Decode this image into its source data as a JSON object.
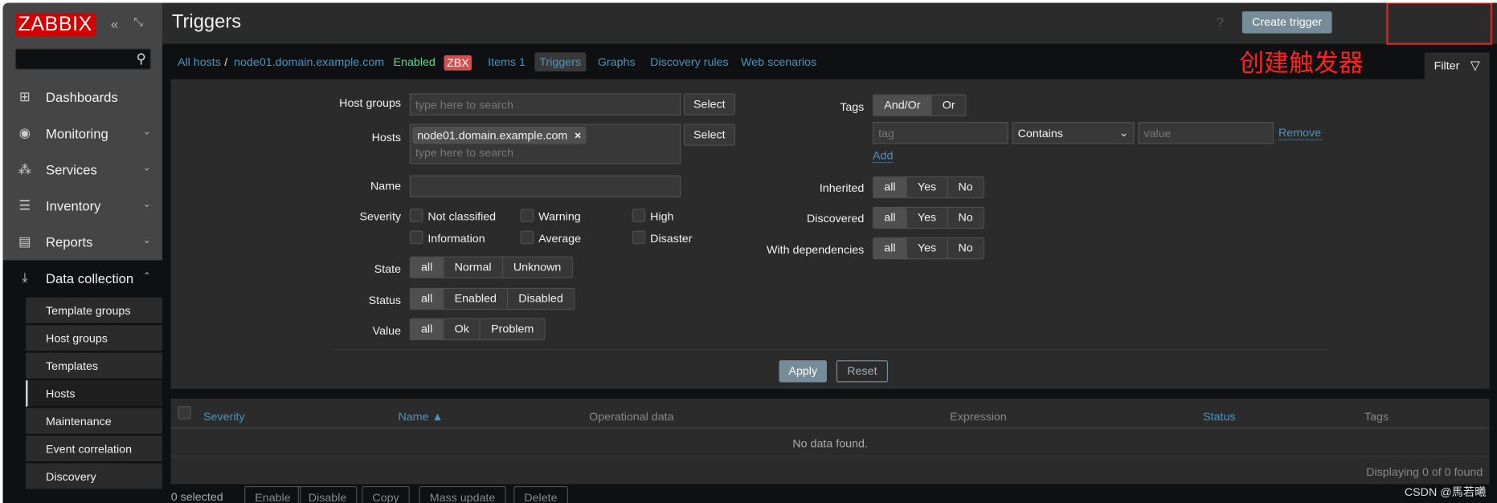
{
  "sidebar": {
    "logo": "ZABBIX",
    "search_placeholder": "",
    "items": [
      {
        "label": "Dashboards",
        "icon": "dashboard-icon"
      },
      {
        "label": "Monitoring",
        "icon": "eye-icon"
      },
      {
        "label": "Services",
        "icon": "hierarchy-icon"
      },
      {
        "label": "Inventory",
        "icon": "list-icon"
      },
      {
        "label": "Reports",
        "icon": "report-icon"
      },
      {
        "label": "Data collection",
        "icon": "download-icon",
        "expanded": true
      }
    ],
    "submenu": [
      {
        "label": "Template groups"
      },
      {
        "label": "Host groups"
      },
      {
        "label": "Templates"
      },
      {
        "label": "Hosts",
        "selected": true
      },
      {
        "label": "Maintenance"
      },
      {
        "label": "Event correlation"
      },
      {
        "label": "Discovery"
      }
    ]
  },
  "header": {
    "title": "Triggers",
    "help": "?",
    "create_button": "Create trigger"
  },
  "annotation": {
    "text": "创建触发器",
    "color": "#ff2020"
  },
  "breadcrumb": {
    "all_hosts": "All hosts",
    "sep": "/",
    "host": "node01.domain.example.com",
    "status": "Enabled",
    "badge": "ZBX",
    "tabs": [
      "Items 1",
      "Triggers",
      "Graphs",
      "Discovery rules",
      "Web scenarios"
    ],
    "active_tab": "Triggers"
  },
  "filter": {
    "tab_label": "Filter",
    "host_groups": {
      "label": "Host groups",
      "placeholder": "type here to search",
      "select": "Select"
    },
    "hosts": {
      "label": "Hosts",
      "chip": "node01.domain.example.com",
      "placeholder": "type here to search",
      "select": "Select"
    },
    "name": {
      "label": "Name",
      "value": ""
    },
    "severity": {
      "label": "Severity",
      "options": [
        "Not classified",
        "Warning",
        "High",
        "Information",
        "Average",
        "Disaster"
      ]
    },
    "state": {
      "label": "State",
      "options": [
        "all",
        "Normal",
        "Unknown"
      ],
      "selected": "all"
    },
    "status": {
      "label": "Status",
      "options": [
        "all",
        "Enabled",
        "Disabled"
      ],
      "selected": "all"
    },
    "value": {
      "label": "Value",
      "options": [
        "all",
        "Ok",
        "Problem"
      ],
      "selected": "all"
    },
    "tags": {
      "label": "Tags",
      "options": [
        "And/Or",
        "Or"
      ],
      "selected": "And/Or",
      "tag_placeholder": "tag",
      "operator": "Contains",
      "value_placeholder": "value",
      "remove": "Remove",
      "add": "Add"
    },
    "inherited": {
      "label": "Inherited",
      "options": [
        "all",
        "Yes",
        "No"
      ],
      "selected": "all"
    },
    "discovered": {
      "label": "Discovered",
      "options": [
        "all",
        "Yes",
        "No"
      ],
      "selected": "all"
    },
    "dependencies": {
      "label": "With dependencies",
      "options": [
        "all",
        "Yes",
        "No"
      ],
      "selected": "all"
    },
    "apply": "Apply",
    "reset": "Reset"
  },
  "table": {
    "columns": [
      "Severity",
      "Name ▲",
      "Operational data",
      "Expression",
      "Status",
      "Tags"
    ],
    "empty": "No data found.",
    "footer": "Displaying 0 of 0 found"
  },
  "actions": {
    "selected": "0 selected",
    "buttons": [
      "Enable",
      "Disable",
      "Copy",
      "Mass update",
      "Delete"
    ]
  },
  "watermark": "CSDN @馬若曦"
}
